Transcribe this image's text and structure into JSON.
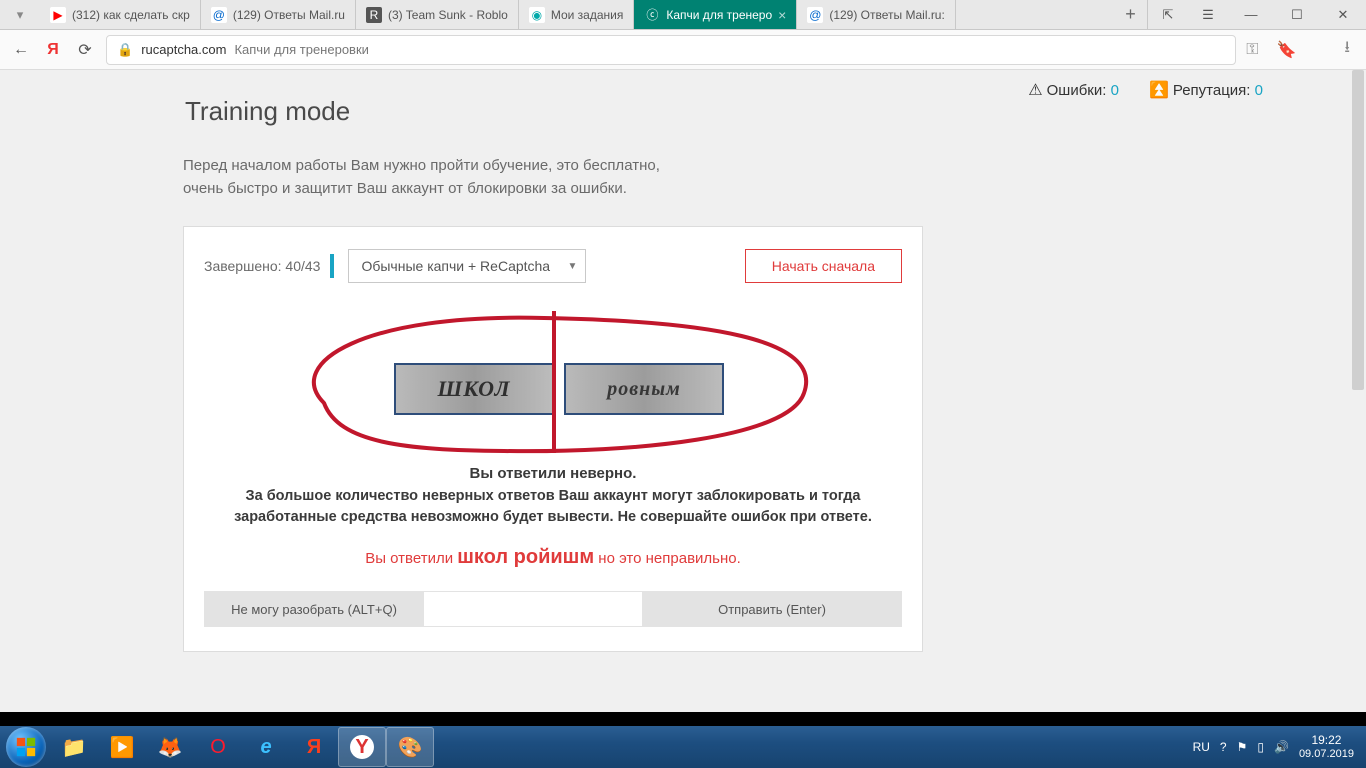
{
  "tabs": [
    {
      "label": "(312) как сделать скр",
      "favBg": "#fff",
      "favColor": "#f00",
      "favGlyph": "▶"
    },
    {
      "label": "(129) Ответы Mail.ru",
      "favBg": "#fff",
      "favColor": "#06c",
      "favGlyph": "@"
    },
    {
      "label": "(3) Team Sunk - Roblo",
      "favBg": "#555",
      "favColor": "#fff",
      "favGlyph": "R"
    },
    {
      "label": "Мои задания",
      "favBg": "#fff",
      "favColor": "#0aa",
      "favGlyph": "◉"
    },
    {
      "label": "Капчи для тренеро",
      "favBg": "#008272",
      "favColor": "#fff",
      "favGlyph": "ⓒ",
      "active": true
    },
    {
      "label": "(129) Ответы Mail.ru:",
      "favBg": "#fff",
      "favColor": "#06c",
      "favGlyph": "@"
    }
  ],
  "address": {
    "host": "rucaptcha.com",
    "path": "Капчи для тренеровки"
  },
  "stats": {
    "errors_label": "Ошибки:",
    "errors_val": "0",
    "rep_label": "Репутация:",
    "rep_val": "0"
  },
  "page": {
    "title": "Training mode",
    "intro": "Перед началом работы Вам нужно пройти обучение, это бесплатно, очень быстро и защитит Ваш аккаунт от блокировки за ошибки.",
    "done_label": "Завершено: 40/43",
    "select_label": "Обычные капчи + ReCaptcha",
    "restart": "Начать сначала",
    "cap_left": "ШКОЛ",
    "cap_right": "ровным",
    "wrong_title": "Вы ответили неверно.",
    "wrong_body": "За большое количество неверных ответов Ваш аккаунт могут заблокировать и тогда заработанные средства невозможно будет вывести. Не совершайте ошибок при ответе.",
    "red_pre": "Вы ответили ",
    "red_ans": "школ ройишм",
    "red_post": " но это неправильно.",
    "btn_cant": "Не могу разобрать (ALT+Q)",
    "btn_send": "Отправить (Enter)"
  },
  "tray": {
    "lang": "RU",
    "time": "19:22",
    "date": "09.07.2019"
  }
}
